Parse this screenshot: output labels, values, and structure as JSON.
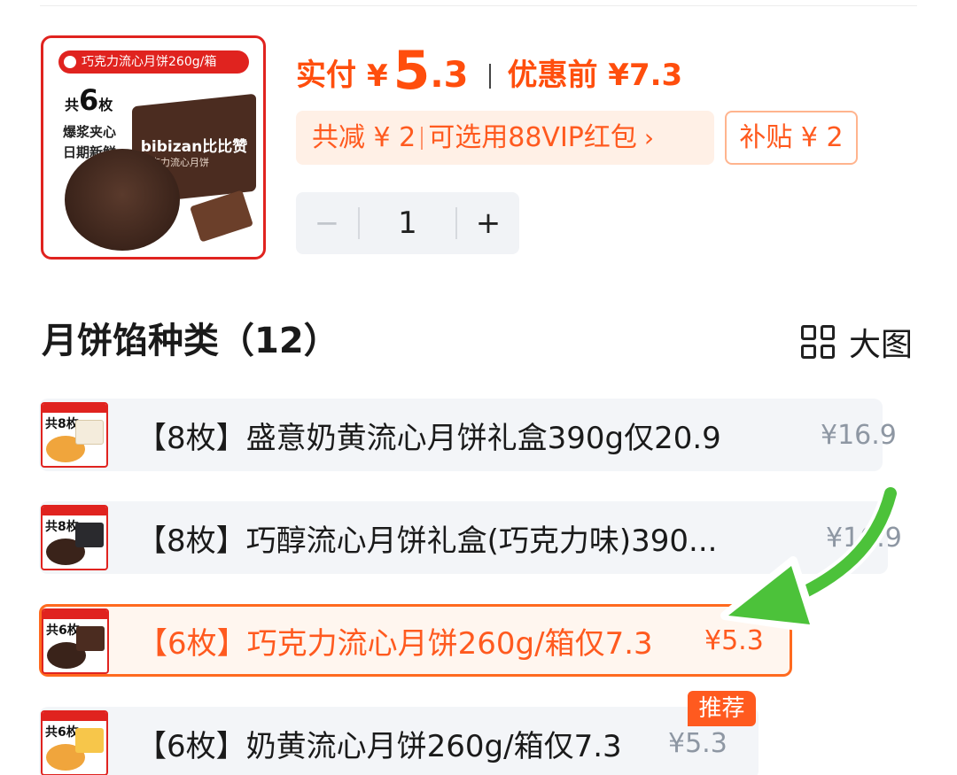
{
  "product": {
    "thumb_banner": "巧克力流心月饼260g/箱",
    "thumb_count_prefix": "共",
    "thumb_count": "6",
    "thumb_count_unit": "枚",
    "thumb_line1": "爆浆夹心",
    "thumb_line2": "日期新鲜",
    "thumb_brand": "bibizan比比赞",
    "thumb_sub": "巧克力流心月饼"
  },
  "price": {
    "label": "实付",
    "currency": "¥",
    "integer": "5",
    "decimal": ".3",
    "before_label": "优惠前 ¥7.3"
  },
  "discount": {
    "reduce": "共减 ¥ 2",
    "vip": "可选用88VIP红包",
    "chevron": "›",
    "subsidy": "补贴 ¥ 2"
  },
  "stepper": {
    "minus": "−",
    "value": "1",
    "plus": "+"
  },
  "section": {
    "title": "月饼馅种类（12）",
    "view_label": "大图"
  },
  "variants": [
    {
      "text": "【8枚】盛意奶黄流心月饼礼盒390g仅20.9",
      "price": "¥16.9",
      "thumb_num": "共8枚",
      "selected": false
    },
    {
      "text": "【8枚】巧醇流心月饼礼盒(巧克力味)390...",
      "price": "¥16.9",
      "thumb_num": "共8枚",
      "selected": false
    },
    {
      "text": "【6枚】巧克力流心月饼260g/箱仅7.3",
      "price": "¥5.3",
      "thumb_num": "共6枚",
      "selected": true
    },
    {
      "text": "【6枚】奶黄流心月饼260g/箱仅7.3",
      "price": "¥5.3",
      "thumb_num": "共6枚",
      "selected": false
    }
  ],
  "recommend_badge": "推荐",
  "colors": {
    "accent": "#ff4e0d",
    "brand_red": "#e0231f",
    "annotation_arrow": "#4cc23a"
  }
}
